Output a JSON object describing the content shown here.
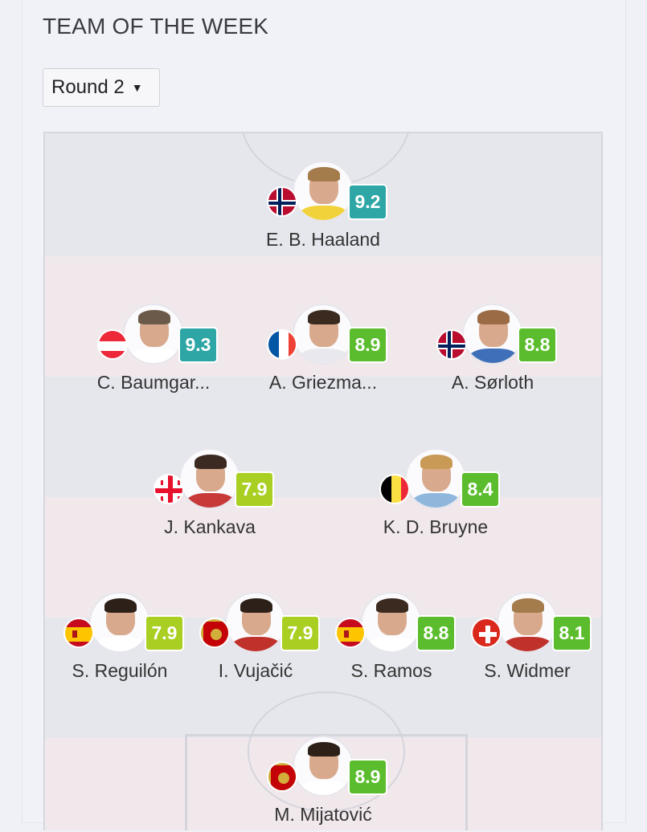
{
  "page": {
    "title": "TEAM OF THE WEEK"
  },
  "round_select": {
    "value": "Round 2"
  },
  "colors": {
    "rating_teal": "#2ea6a6",
    "rating_green": "#5bbd2d",
    "rating_lime": "#a9cf22",
    "band_light": "#f1e8ec",
    "band_gray": "#e6e7ec"
  },
  "players": [
    {
      "name": "E. B. Haaland",
      "rating": "9.2",
      "rating_color": "#2ea6a6",
      "flag": "norway",
      "shirt": "#f2d23a",
      "hair": "#a47b4b"
    },
    {
      "name": "C. Baumgar...",
      "rating": "9.3",
      "rating_color": "#2ea6a6",
      "flag": "austria",
      "shirt": "#ffffff",
      "hair": "#6b5a4a"
    },
    {
      "name": "A. Griezma...",
      "rating": "8.9",
      "rating_color": "#5bbd2d",
      "flag": "france",
      "shirt": "#e8e8ee",
      "hair": "#3a2a20"
    },
    {
      "name": "A. Sørloth",
      "rating": "8.8",
      "rating_color": "#5bbd2d",
      "flag": "norway",
      "shirt": "#3f6fb8",
      "hair": "#9b6b45"
    },
    {
      "name": "J. Kankava",
      "rating": "7.9",
      "rating_color": "#a9cf22",
      "flag": "georgia",
      "shirt": "#c83a3a",
      "hair": "#3b2a22"
    },
    {
      "name": "K. D. Bruyne",
      "rating": "8.4",
      "rating_color": "#5bbd2d",
      "flag": "belgium",
      "shirt": "#8fb7dc",
      "hair": "#c99a55"
    },
    {
      "name": "S. Reguilón",
      "rating": "7.9",
      "rating_color": "#a9cf22",
      "flag": "spain",
      "shirt": "#ffffff",
      "hair": "#2d2018"
    },
    {
      "name": "I. Vujačić",
      "rating": "7.9",
      "rating_color": "#a9cf22",
      "flag": "montenegro",
      "shirt": "#c0312b",
      "hair": "#2d2018"
    },
    {
      "name": "S. Ramos",
      "rating": "8.8",
      "rating_color": "#5bbd2d",
      "flag": "spain",
      "shirt": "#ffffff",
      "hair": "#3a2a20"
    },
    {
      "name": "S. Widmer",
      "rating": "8.1",
      "rating_color": "#5bbd2d",
      "flag": "switzerland",
      "shirt": "#c0312b",
      "hair": "#a47b4b"
    },
    {
      "name": "M. Mijatović",
      "rating": "8.9",
      "rating_color": "#5bbd2d",
      "flag": "montenegro",
      "shirt": "#ffffff",
      "hair": "#2d2018"
    }
  ]
}
